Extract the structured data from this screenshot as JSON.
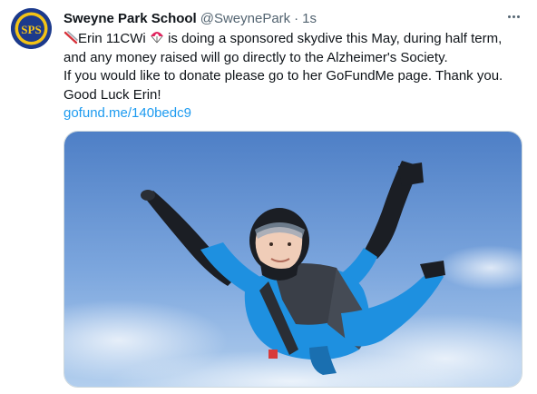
{
  "tweet": {
    "author_name": "Sweyne Park School",
    "author_handle": "@SweynePark",
    "separator": "·",
    "timestamp": "1s",
    "avatar_icon": "school-crest-icon",
    "avatar_text": "SPS",
    "more_icon": "more-options-icon",
    "lines": [
      {
        "emoji": "skis-icon",
        "pre": "Erin 11CWi ",
        "emoji2": "parachute-icon",
        "post": " is doing a sponsored skydive this May, during half term,"
      },
      {
        "text": "and any money raised will go directly to  the Alzheimer's Society."
      },
      {
        "text": "If you would like to donate please  go to her GoFundMe page. Thank you."
      },
      {
        "text": "Good Luck Erin!"
      }
    ],
    "link_text": "gofund.me/140bedc9",
    "media_alt": "skydiver-photo"
  },
  "colors": {
    "link": "#1d9bf0",
    "muted": "#536471",
    "sky_top": "#4e7fc6",
    "sky_bottom": "#aac8ec",
    "suit_blue": "#1e90e0"
  }
}
